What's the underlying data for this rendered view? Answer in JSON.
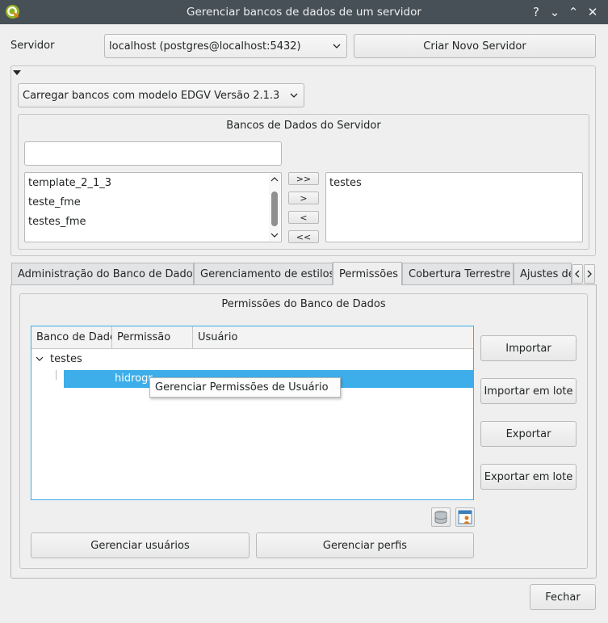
{
  "window": {
    "title": "Gerenciar bancos de dados de um servidor",
    "controls": [
      "?",
      "⌄",
      "⌃",
      "✕"
    ]
  },
  "server": {
    "label": "Servidor",
    "selected": "localhost (postgres@localhost:5432)",
    "create_button": "Criar Novo Servidor"
  },
  "load_combo": "Carregar bancos com modelo EDGV Versão 2.1.3",
  "databases_group": {
    "title": "Bancos de Dados do Servidor",
    "filter_value": "",
    "available": [
      "template_2_1_3",
      "teste_fme",
      "testes_fme"
    ],
    "selected": [
      "testes"
    ],
    "move_buttons": [
      ">>",
      ">",
      "<",
      "<<"
    ]
  },
  "tabs": [
    "Administração do Banco de Dados",
    "Gerenciamento de estilos",
    "Permissões",
    "Cobertura Terrestre",
    "Ajustes de"
  ],
  "active_tab": "Permissões",
  "permissions_group": {
    "title": "Permissões do Banco de Dados",
    "columns": [
      "Banco de Dados",
      "Permissão",
      "Usuário"
    ],
    "tree_root": "testes",
    "tree_child": "hidrogr",
    "context_menu_item": "Gerenciar Permissões de Usuário",
    "side_buttons": [
      "Importar",
      "Importar em lote",
      "Exportar",
      "Exportar em lote"
    ],
    "bottom_buttons": [
      "Gerenciar usuários",
      "Gerenciar perfis"
    ]
  },
  "close_button": "Fechar",
  "colors": {
    "titlebar": "#475057",
    "selection": "#3daee9",
    "window_bg": "#efefef"
  }
}
